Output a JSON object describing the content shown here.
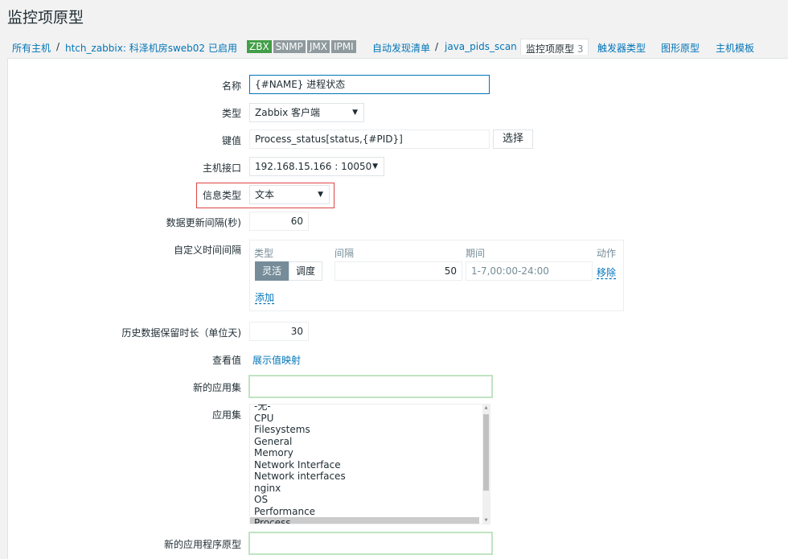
{
  "page_title": "监控项原型",
  "nav": {
    "all_hosts": "所有主机",
    "sep": "/",
    "host": "htch_zabbix: 科泽机房sweb02",
    "status": "已启用",
    "badges": [
      "ZBX",
      "SNMP",
      "JMX",
      "IPMI"
    ],
    "discovery_list": "自动发现清单",
    "discovery_rule": "java_pids_scan",
    "item_prototypes": "监控项原型",
    "item_prototypes_count": "3",
    "trigger_prototypes": "触发器类型",
    "graph_prototypes": "图形原型",
    "host_templates": "主机模板"
  },
  "form": {
    "name_label": "名称",
    "name_value": "{#NAME} 进程状态",
    "type_label": "类型",
    "type_value": "Zabbix 客户端",
    "key_label": "键值",
    "key_value": "Process_status[status,{#PID}]",
    "key_select_button": "选择",
    "interface_label": "主机接口",
    "interface_value": "192.168.15.166 : 10050",
    "info_type_label": "信息类型",
    "info_type_value": "文本",
    "update_interval_label": "数据更新间隔(秒)",
    "update_interval_value": "60",
    "custom_intervals_label": "自定义时间间隔",
    "custom_intervals": {
      "col_type": "类型",
      "col_interval": "间隔",
      "col_period": "期间",
      "col_action": "动作",
      "flexible": "灵活",
      "scheduling": "调度",
      "interval_value": "50",
      "period_value": "1-7,00:00-24:00",
      "remove": "移除",
      "add": "添加"
    },
    "history_label": "历史数据保留时长（单位天)",
    "history_value": "30",
    "show_value_label": "查看值",
    "show_value_link": "展示值映射",
    "new_application_label": "新的应用集",
    "new_application_value": "",
    "applications_label": "应用集",
    "applications": [
      "-无-",
      "CPU",
      "Filesystems",
      "General",
      "Memory",
      "Network Interface",
      "Network interfaces",
      "nginx",
      "OS",
      "Performance",
      "Process"
    ],
    "applications_selected": "Process",
    "new_app_prototype_label": "新的应用程序原型",
    "new_app_prototype_value": ""
  },
  "colors": {
    "link": "#0275b8",
    "enabled_green": "#429e47",
    "badge_gray": "#8f9a9e",
    "highlight_red": "#dd4444",
    "green_border": "#c0e3c2"
  }
}
